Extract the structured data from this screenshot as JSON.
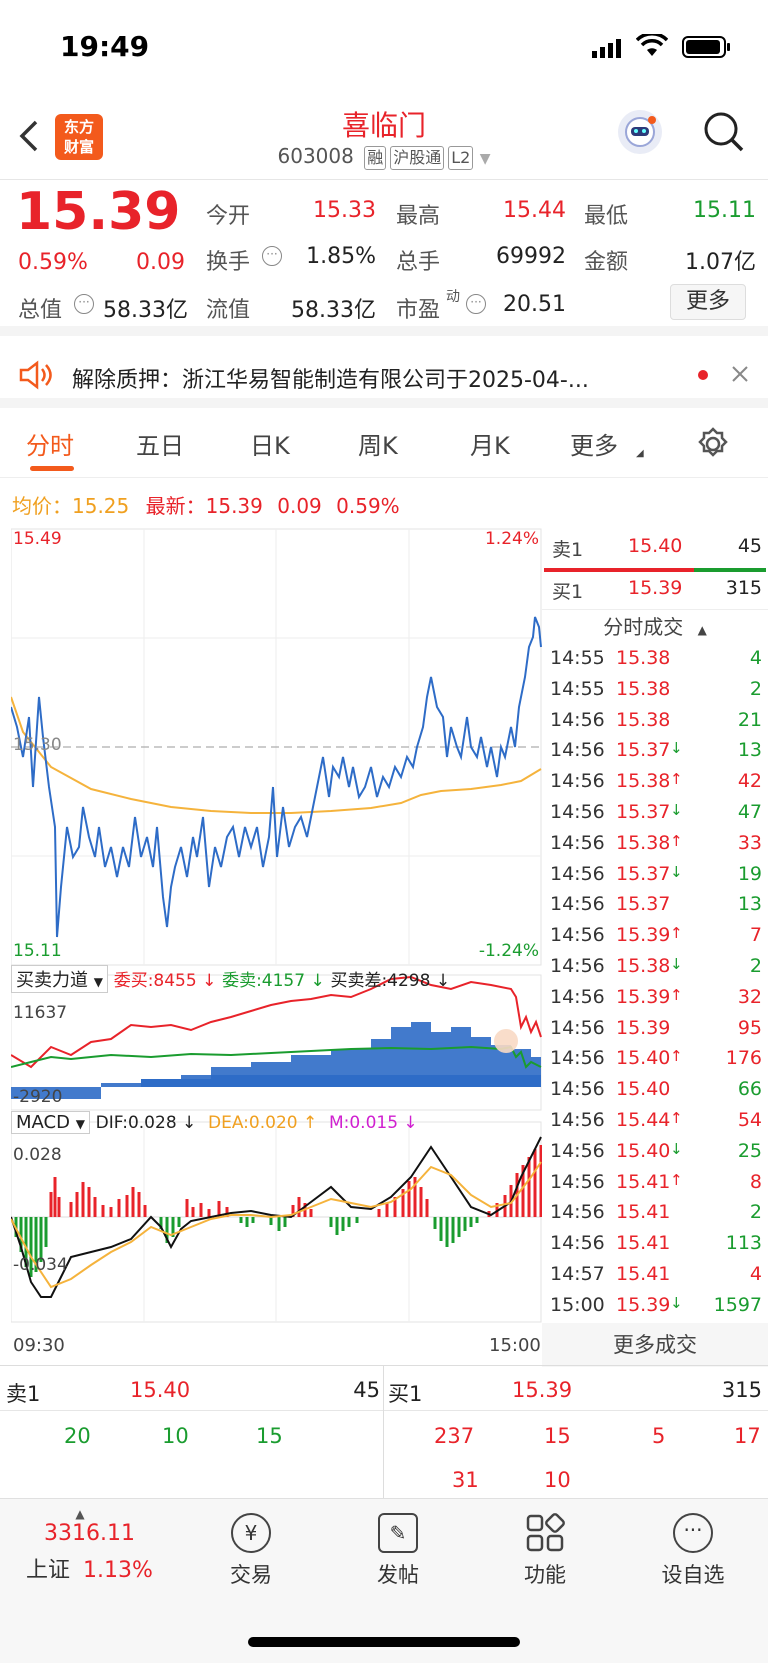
{
  "status_bar": {
    "time": "19:49"
  },
  "header": {
    "logo_line1": "东方",
    "logo_line2": "财富",
    "title": "喜临门",
    "code": "603008",
    "tags": [
      "融",
      "沪股通",
      "L2"
    ]
  },
  "quote": {
    "price": "15.39",
    "change_pct": "0.59%",
    "change": "0.09",
    "open_label": "今开",
    "open": "15.33",
    "high_label": "最高",
    "high": "15.44",
    "low_label": "最低",
    "low": "15.11",
    "turnover_label": "换手",
    "turnover": "1.85%",
    "volume_label": "总手",
    "volume": "69992",
    "amount_label": "金额",
    "amount": "1.07亿",
    "mcap_label": "总值",
    "mcap": "58.33亿",
    "float_label": "流值",
    "float": "58.33亿",
    "pe_label": "市盈",
    "pe_sup": "动",
    "pe": "20.51",
    "more_label": "更多"
  },
  "notice": {
    "text": "解除质押：浙江华易智能制造有限公司于2025-04-..."
  },
  "tabs": [
    "分时",
    "五日",
    "日K",
    "周K",
    "月K",
    "更多"
  ],
  "chart_info": {
    "avg_label": "均价：",
    "avg": "15.25",
    "latest_label": "最新：",
    "latest": "15.39",
    "chg": "0.09",
    "pct": "0.59%"
  },
  "chart_labels": {
    "price_top": "15.49",
    "price_bottom": "15.11",
    "pct_top": "1.24%",
    "pct_bottom": "-1.24%",
    "mid_price": "15.30",
    "force_title": "买卖力道",
    "force_buy": "委买:8455 ↓",
    "force_sell": "委卖:4157 ↓",
    "force_diff": "买卖差:4298 ↓",
    "force_top": "11637",
    "force_bottom": "-2920",
    "macd_title": "MACD",
    "dif": "DIF:0.028 ↓",
    "dea": "DEA:0.020 ↑",
    "m": "M:0.015 ↓",
    "macd_top": "0.028",
    "macd_bottom": "-0.034",
    "time_start": "09:30",
    "time_end": "15:00"
  },
  "order_book_right": {
    "sell_label": "卖1",
    "sell_price": "15.40",
    "sell_vol": "45",
    "buy_label": "买1",
    "buy_price": "15.39",
    "buy_vol": "315"
  },
  "ticks_title": "分时成交",
  "ticks": [
    {
      "t": "14:55",
      "p": "15.38",
      "a": "",
      "v": "4",
      "c": "red",
      "vc": "green"
    },
    {
      "t": "14:55",
      "p": "15.38",
      "a": "",
      "v": "2",
      "c": "red",
      "vc": "green"
    },
    {
      "t": "14:56",
      "p": "15.38",
      "a": "",
      "v": "21",
      "c": "red",
      "vc": "green"
    },
    {
      "t": "14:56",
      "p": "15.37",
      "a": "↓",
      "v": "13",
      "c": "red",
      "vc": "green"
    },
    {
      "t": "14:56",
      "p": "15.38",
      "a": "↑",
      "v": "42",
      "c": "red",
      "vc": "red"
    },
    {
      "t": "14:56",
      "p": "15.37",
      "a": "↓",
      "v": "47",
      "c": "red",
      "vc": "green"
    },
    {
      "t": "14:56",
      "p": "15.38",
      "a": "↑",
      "v": "33",
      "c": "red",
      "vc": "red"
    },
    {
      "t": "14:56",
      "p": "15.37",
      "a": "↓",
      "v": "19",
      "c": "red",
      "vc": "green"
    },
    {
      "t": "14:56",
      "p": "15.37",
      "a": "",
      "v": "13",
      "c": "red",
      "vc": "green"
    },
    {
      "t": "14:56",
      "p": "15.39",
      "a": "↑",
      "v": "7",
      "c": "red",
      "vc": "red"
    },
    {
      "t": "14:56",
      "p": "15.38",
      "a": "↓",
      "v": "2",
      "c": "red",
      "vc": "green"
    },
    {
      "t": "14:56",
      "p": "15.39",
      "a": "↑",
      "v": "32",
      "c": "red",
      "vc": "red"
    },
    {
      "t": "14:56",
      "p": "15.39",
      "a": "",
      "v": "95",
      "c": "red",
      "vc": "red"
    },
    {
      "t": "14:56",
      "p": "15.40",
      "a": "↑",
      "v": "176",
      "c": "red",
      "vc": "red"
    },
    {
      "t": "14:56",
      "p": "15.40",
      "a": "",
      "v": "66",
      "c": "red",
      "vc": "green"
    },
    {
      "t": "14:56",
      "p": "15.44",
      "a": "↑",
      "v": "54",
      "c": "red",
      "vc": "red"
    },
    {
      "t": "14:56",
      "p": "15.40",
      "a": "↓",
      "v": "25",
      "c": "red",
      "vc": "green"
    },
    {
      "t": "14:56",
      "p": "15.41",
      "a": "↑",
      "v": "8",
      "c": "red",
      "vc": "red"
    },
    {
      "t": "14:56",
      "p": "15.41",
      "a": "",
      "v": "2",
      "c": "red",
      "vc": "green"
    },
    {
      "t": "14:56",
      "p": "15.41",
      "a": "",
      "v": "113",
      "c": "red",
      "vc": "green"
    },
    {
      "t": "14:57",
      "p": "15.41",
      "a": "",
      "v": "4",
      "c": "red",
      "vc": "red"
    },
    {
      "t": "15:00",
      "p": "15.39",
      "a": "↓",
      "v": "1597",
      "c": "red",
      "vc": "green"
    }
  ],
  "more_ticks_label": "更多成交",
  "order_book_bottom": {
    "sell_label": "卖1",
    "sell_price": "15.40",
    "sell_vol": "45",
    "sell_queue": [
      "20",
      "10",
      "15"
    ],
    "buy_label": "买1",
    "buy_price": "15.39",
    "buy_vol": "315",
    "buy_queue_row1": [
      "237",
      "15",
      "5",
      "17"
    ],
    "buy_queue_row2": [
      "31",
      "10"
    ]
  },
  "bottom_nav": {
    "index_value": "3316.11",
    "index_name": "上证",
    "index_pct": "1.13%",
    "items": [
      "交易",
      "发帖",
      "功能",
      "设自选"
    ]
  }
}
